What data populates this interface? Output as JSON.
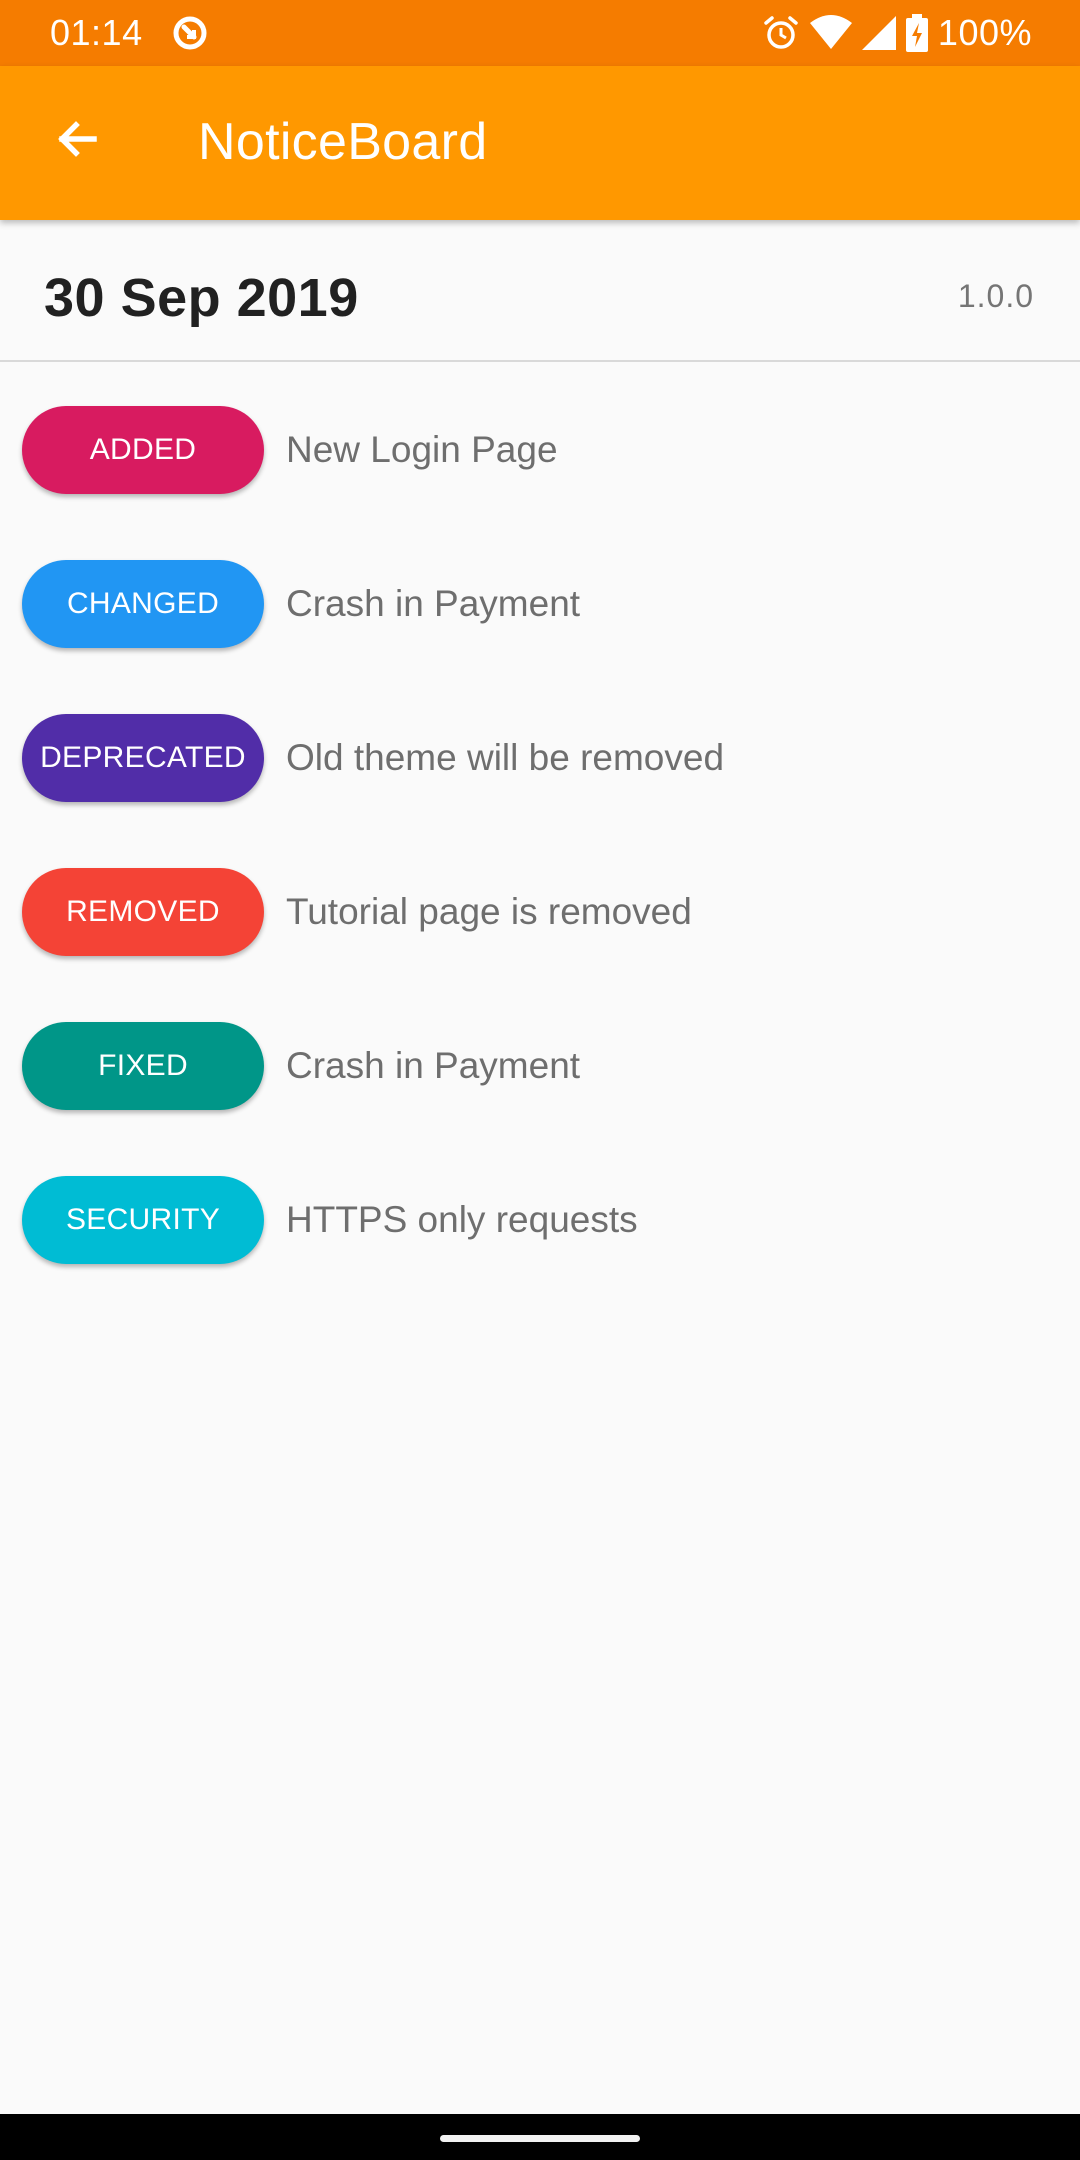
{
  "status_bar": {
    "time": "01:14",
    "battery": "100%",
    "icons": [
      "sync-icon",
      "alarm-icon",
      "wifi-icon",
      "signal-icon",
      "battery-charging-icon"
    ]
  },
  "app_bar": {
    "title": "NoticeBoard",
    "back_icon": "arrow-back-icon",
    "color": "#ff9800",
    "status_color": "#f57c00"
  },
  "release": {
    "date": "30 Sep 2019",
    "version": "1.0.0"
  },
  "changes": [
    {
      "type": "ADDED",
      "text": "New Login Page",
      "color": "#d81b60"
    },
    {
      "type": "CHANGED",
      "text": "Crash in Payment",
      "color": "#2196f3"
    },
    {
      "type": "DEPRECATED",
      "text": "Old theme will be removed",
      "color": "#512da8"
    },
    {
      "type": "REMOVED",
      "text": "Tutorial page is removed",
      "color": "#f44336"
    },
    {
      "type": "FIXED",
      "text": "Crash in Payment",
      "color": "#009688"
    },
    {
      "type": "SECURITY",
      "text": "HTTPS only requests",
      "color": "#00bcd4"
    }
  ]
}
